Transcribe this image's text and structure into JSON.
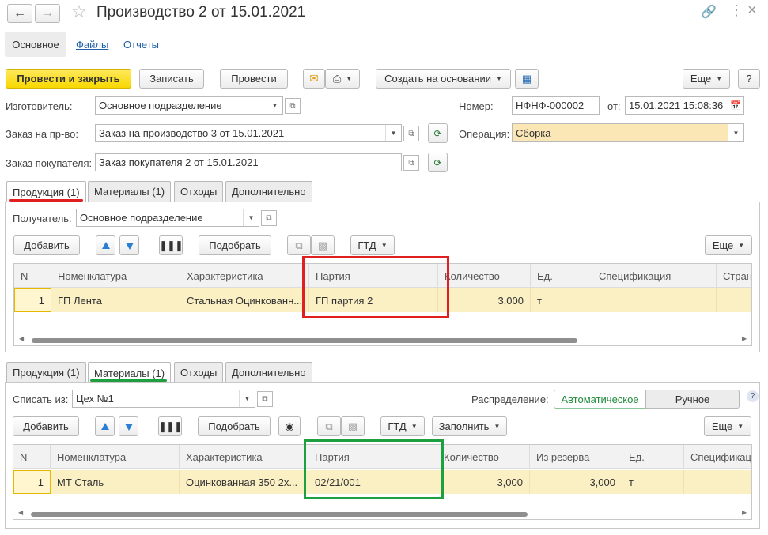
{
  "window": {
    "title": "Производство 2 от 15.01.2021"
  },
  "nav": {
    "main": "Основное",
    "files": "Файлы",
    "reports": "Отчеты"
  },
  "toolbar": {
    "post_close": "Провести и закрыть",
    "save": "Записать",
    "post": "Провести",
    "create_based": "Создать на основании",
    "more": "Еще",
    "help": "?"
  },
  "header": {
    "maker_label": "Изготовитель:",
    "maker": "Основное подразделение",
    "prod_order_label": "Заказ на пр-во:",
    "prod_order": "Заказ на производство 3 от 15.01.2021",
    "cust_order_label": "Заказ покупателя:",
    "cust_order": "Заказ покупателя 2 от 15.01.2021",
    "number_label": "Номер:",
    "number": "НФНФ-000002",
    "date_label": "от:",
    "date": "15.01.2021 15:08:36",
    "operation_label": "Операция:",
    "operation": "Сборка"
  },
  "tabs": [
    "Продукция (1)",
    "Материалы (1)",
    "Отходы",
    "Дополнительно"
  ],
  "products": {
    "receiver_label": "Получатель:",
    "receiver": "Основное подразделение",
    "add": "Добавить",
    "pick": "Подобрать",
    "gtd": "ГТД",
    "more": "Еще",
    "columns": [
      "N",
      "Номенклатура",
      "Характеристика",
      "Партия",
      "Количество",
      "Ед.",
      "Спецификация",
      "Страна"
    ],
    "rows": [
      {
        "n": "1",
        "item": "ГП Лента",
        "char": "Стальная Оцинкованн...",
        "batch": "ГП партия 2",
        "qty": "3,000",
        "unit": "т",
        "spec": "",
        "country": ""
      }
    ]
  },
  "materials": {
    "writeoff_label": "Списать из:",
    "writeoff": "Цех №1",
    "distribution_label": "Распределение:",
    "auto": "Автоматическое",
    "manual": "Ручное",
    "hint": "?",
    "add": "Добавить",
    "pick": "Подобрать",
    "gtd": "ГТД",
    "fill": "Заполнить",
    "more": "Еще",
    "columns": [
      "N",
      "Номенклатура",
      "Характеристика",
      "Партия",
      "Количество",
      "Из резерва",
      "Ед.",
      "Спецификация"
    ],
    "rows": [
      {
        "n": "1",
        "item": "МТ Сталь",
        "char": "Оцинкованная 350 2х...",
        "batch": "02/21/001",
        "qty": "3,000",
        "reserve": "3,000",
        "unit": "т",
        "spec": ""
      }
    ]
  },
  "colors": {
    "accent_yellow": "#f8d800",
    "highlight_red": "#e02020",
    "highlight_green": "#1fa040",
    "row_bg": "#fbefc4"
  }
}
